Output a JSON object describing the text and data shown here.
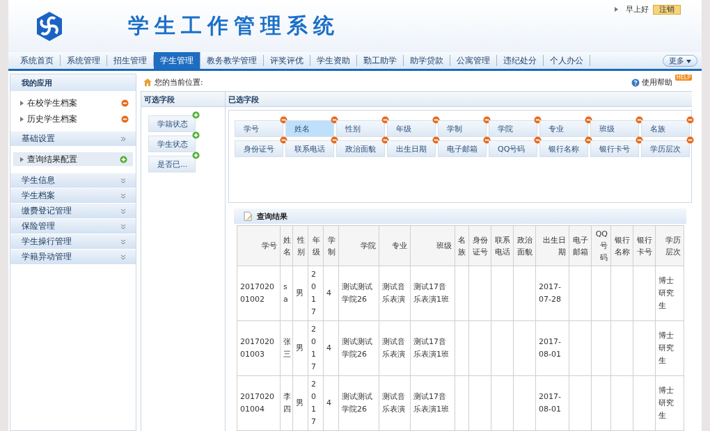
{
  "header": {
    "title": "学生工作管理系统",
    "greeting": "早上好",
    "logout": "注销"
  },
  "nav": {
    "items": [
      {
        "label": "系统首页",
        "selected": false
      },
      {
        "label": "系统管理",
        "selected": false
      },
      {
        "label": "招生管理",
        "selected": false
      },
      {
        "label": "学生管理",
        "selected": true
      },
      {
        "label": "教务教学管理",
        "selected": false
      },
      {
        "label": "评奖评优",
        "selected": false
      },
      {
        "label": "学生资助",
        "selected": false
      },
      {
        "label": "勤工助学",
        "selected": false
      },
      {
        "label": "助学贷款",
        "selected": false
      },
      {
        "label": "公寓管理",
        "selected": false
      },
      {
        "label": "违纪处分",
        "selected": false
      },
      {
        "label": "个人办公",
        "selected": false
      }
    ],
    "more": "更多"
  },
  "sidebar": {
    "title": "我的应用",
    "apps": [
      "在校学生档案",
      "历史学生档案"
    ],
    "basic_settings": "基础设置",
    "config_item": "查询结果配置",
    "sections": [
      "学生信息",
      "学生档案",
      "缴费登记管理",
      "保险管理",
      "学生操行管理",
      "学籍异动管理"
    ]
  },
  "breadcrumb": {
    "label": "您的当前位置:",
    "help": "使用帮助",
    "help_badge": "HELP"
  },
  "available": {
    "title": "可选字段",
    "fields": [
      "学籍状态",
      "学生状态",
      "是否已..."
    ]
  },
  "chosen": {
    "title": "已选字段",
    "fields": [
      {
        "label": "学号",
        "selected": false
      },
      {
        "label": "姓名",
        "selected": true
      },
      {
        "label": "性别",
        "selected": false
      },
      {
        "label": "年级",
        "selected": false
      },
      {
        "label": "学制",
        "selected": false
      },
      {
        "label": "学院",
        "selected": false
      },
      {
        "label": "专业",
        "selected": false
      },
      {
        "label": "班级",
        "selected": false
      },
      {
        "label": "名族",
        "selected": false
      },
      {
        "label": "身份证号",
        "selected": false
      },
      {
        "label": "联系电话",
        "selected": false
      },
      {
        "label": "政治面貌",
        "selected": false
      },
      {
        "label": "出生日期",
        "selected": false
      },
      {
        "label": "电子邮箱",
        "selected": false
      },
      {
        "label": "QQ号码",
        "selected": false
      },
      {
        "label": "银行名称",
        "selected": false
      },
      {
        "label": "银行卡号",
        "selected": false
      },
      {
        "label": "学历层次",
        "selected": false
      }
    ]
  },
  "results": {
    "title": "查询结果",
    "columns": [
      "学号",
      "姓名",
      "性别",
      "年级",
      "学制",
      "学院",
      "专业",
      "班级",
      "名族",
      "身份证号",
      "联系电话",
      "政治面貌",
      "出生日期",
      "电子邮箱",
      "QQ号码",
      "银行名称",
      "银行卡号",
      "学历层次"
    ],
    "rows": [
      [
        "201702001002",
        "sa",
        "男",
        "2017",
        "4",
        "测试测试学院26",
        "测试音乐表演",
        "测试17音乐表演1班",
        "",
        "",
        "",
        "",
        "2017-07-28",
        "",
        "",
        "",
        "",
        "博士研究生"
      ],
      [
        "201702001003",
        "张三",
        "男",
        "2017",
        "4",
        "测试测试学院26",
        "测试音乐表演",
        "测试17音乐表演1班",
        "",
        "",
        "",
        "",
        "2017-08-01",
        "",
        "",
        "",
        "",
        "博士研究生"
      ],
      [
        "201702001004",
        "李四",
        "男",
        "2017",
        "4",
        "测试测试学院26",
        "测试音乐表演",
        "测试17音乐表演1班",
        "",
        "",
        "",
        "",
        "2017-08-01",
        "",
        "",
        "",
        "",
        "博士研究生"
      ]
    ]
  }
}
